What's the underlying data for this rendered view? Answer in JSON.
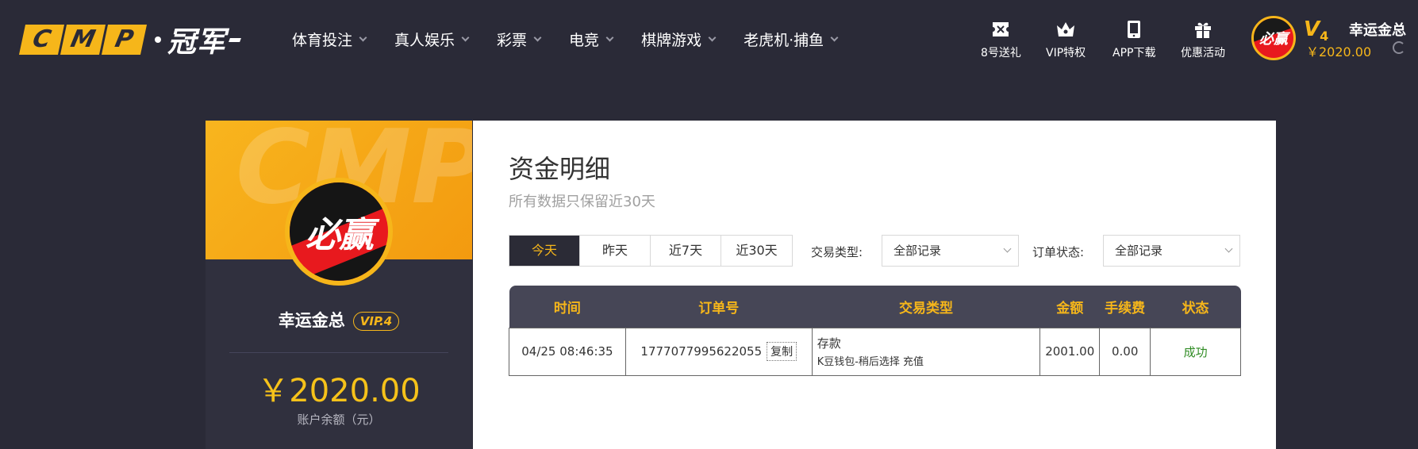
{
  "brand": {
    "letters": [
      "C",
      "M",
      "P"
    ],
    "cn": "冠军"
  },
  "nav": [
    {
      "label": "体育投注"
    },
    {
      "label": "真人娱乐"
    },
    {
      "label": "彩票"
    },
    {
      "label": "电竞"
    },
    {
      "label": "棋牌游戏"
    },
    {
      "label": "老虎机·捕鱼"
    }
  ],
  "tools": [
    {
      "label": "8号送礼",
      "icon": "ticket-icon"
    },
    {
      "label": "VIP特权",
      "icon": "crown-icon"
    },
    {
      "label": "APP下载",
      "icon": "mobile-icon"
    },
    {
      "label": "优惠活动",
      "icon": "gift-icon"
    }
  ],
  "user": {
    "avatar_text": "必赢",
    "vip_level": "V",
    "vip_num": "4",
    "name": "幸运金总",
    "balance_top": "￥2020.00",
    "vip_tag": "VIP.4",
    "balance": "￥2020.00",
    "balance_label": "账户余额（元）",
    "banner_watermark": "CMP"
  },
  "page": {
    "title": "资金明细",
    "subtitle": "所有数据只保留近30天"
  },
  "filters": {
    "tabs": [
      {
        "label": "今天",
        "active": true
      },
      {
        "label": "昨天",
        "active": false
      },
      {
        "label": "近7天",
        "active": false
      },
      {
        "label": "近30天",
        "active": false
      }
    ],
    "type_label": "交易类型:",
    "type_value": "全部记录",
    "status_label": "订单状态:",
    "status_value": "全部记录"
  },
  "table": {
    "columns": [
      "时间",
      "订单号",
      "交易类型",
      "金额",
      "手续费",
      "状态"
    ],
    "rows": [
      {
        "time": "04/25 08:46:35",
        "order_no": "1777077995622055",
        "copy_label": "复制",
        "type_main": "存款",
        "type_detail": "K豆钱包-稍后选择 充值",
        "amount": "2001.00",
        "fee": "0.00",
        "status": "成功"
      }
    ]
  },
  "colors": {
    "accent": "#f6b61a",
    "header_bg": "#2a2a37",
    "table_head_bg": "#464656",
    "success": "#2e8b22"
  }
}
